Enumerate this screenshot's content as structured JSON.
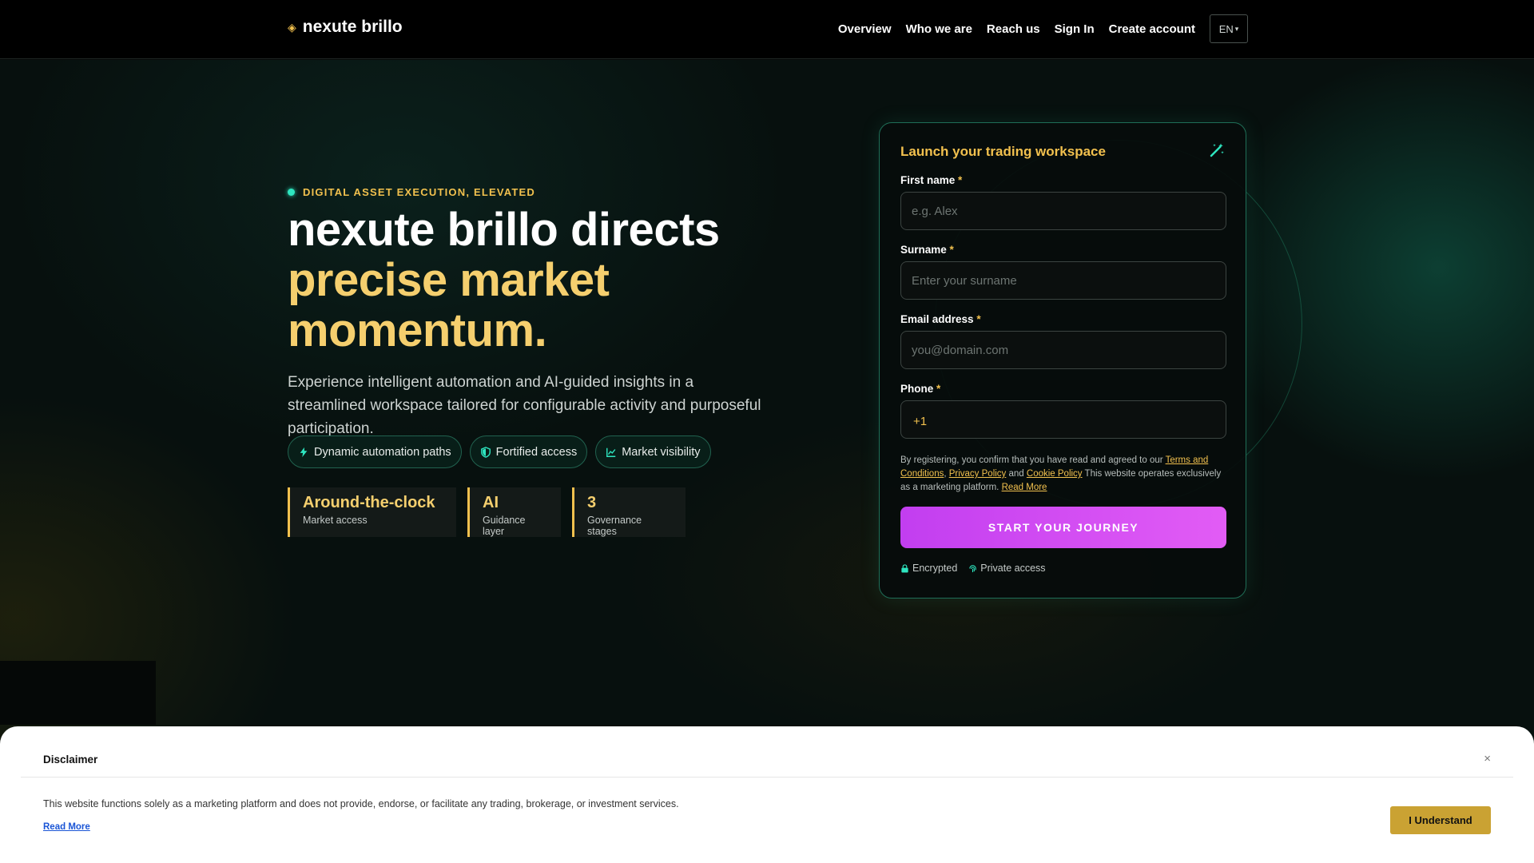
{
  "header": {
    "brand": "nexute brillo",
    "brand_icon": "diamond-icon",
    "nav": [
      "Overview",
      "Who we are",
      "Reach us",
      "Sign In",
      "Create account"
    ],
    "language": "EN"
  },
  "hero": {
    "eyebrow": "DIGITAL ASSET EXECUTION, ELEVATED",
    "headline_line1": "nexute brillo directs",
    "headline_line2": "precise market",
    "headline_line3": "momentum.",
    "lead": "Experience intelligent automation and AI-guided insights in a streamlined workspace tailored for configurable activity and purposeful participation.",
    "chips": [
      {
        "label": "Dynamic automation paths",
        "icon": "bolt-icon"
      },
      {
        "label": "Fortified access",
        "icon": "shield-icon"
      },
      {
        "label": "Market visibility",
        "icon": "chart-icon"
      }
    ],
    "stats": [
      {
        "value": "Around-the-clock",
        "label": "Market access"
      },
      {
        "value": "AI",
        "label": "Guidance layer"
      },
      {
        "value": "3",
        "label": "Governance stages"
      }
    ]
  },
  "form": {
    "title": "Launch your trading workspace",
    "first_name_label": "First name",
    "first_name_placeholder": "e.g. Alex",
    "surname_label": "Surname",
    "surname_placeholder": "Enter your surname",
    "email_label": "Email address",
    "email_placeholder": "you@domain.com",
    "phone_label": "Phone",
    "phone_prefix": "+1",
    "required_mark": "*",
    "consent_prefix": "By registering, you confirm that you have read and agreed to our ",
    "terms_link": "Terms and Conditions",
    "sep1": ", ",
    "privacy_link": "Privacy Policy",
    "and_text": " and ",
    "cookie_link": "Cookie Policy",
    "consent_suffix": " This website operates exclusively as a marketing platform. ",
    "read_more": "Read More",
    "cta": "START YOUR JOURNEY",
    "secure_1": "Encrypted",
    "secure_2": "Private access"
  },
  "disclaimer": {
    "title": "Disclaimer",
    "close": "×",
    "text": "This website functions solely as a marketing platform and does not provide, endorse, or facilitate any trading, brokerage, or investment services.",
    "read_more": "Read More",
    "button": "I Understand"
  },
  "colors": {
    "accent_gold": "#f2c14e",
    "accent_teal": "#2ee6c0",
    "cta_magenta": "#d24cf3",
    "disclaimer_button": "#caa233"
  }
}
